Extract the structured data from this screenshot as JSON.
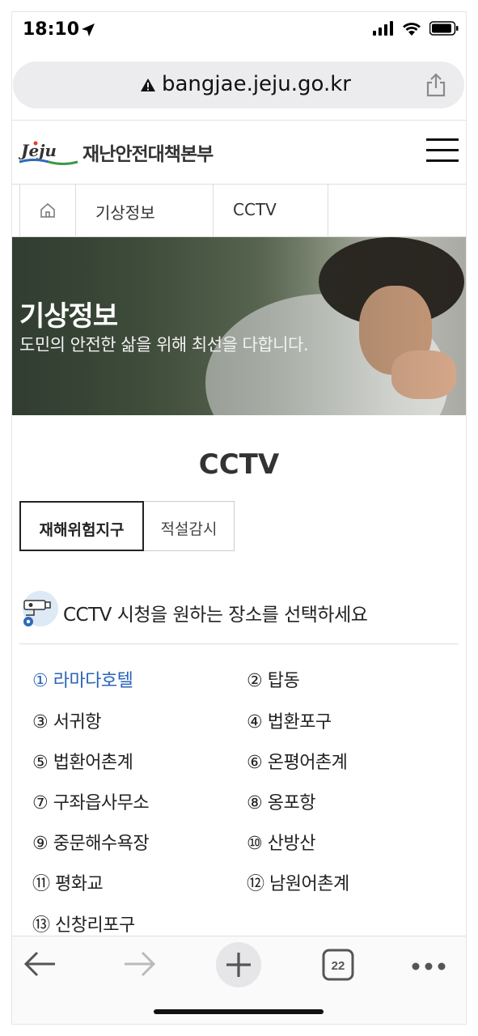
{
  "status_bar": {
    "time": "18:10",
    "icons": [
      "location-arrow-icon",
      "cellular-signal-icon",
      "wifi-icon",
      "battery-icon"
    ]
  },
  "browser": {
    "url": "bangjae.jeju.go.kr",
    "tab_count": "22"
  },
  "site": {
    "logo_text": "Jeju",
    "title": "재난안전대책본부"
  },
  "breadcrumb": {
    "items": [
      "기상정보",
      "CCTV"
    ]
  },
  "hero": {
    "title": "기상정보",
    "subtitle": "도민의 안전한 삶을 위해 최선을 다합니다."
  },
  "page": {
    "title": "CCTV",
    "tabs": [
      {
        "label": "재해위험지구",
        "active": true
      },
      {
        "label": "적설감시",
        "active": false
      }
    ],
    "instruction": "CCTV 시청을 원하는 장소를 선택하세요"
  },
  "locations": [
    {
      "label": "① 라마다호텔",
      "active": true
    },
    {
      "label": "② 탑동",
      "active": false
    },
    {
      "label": "③ 서귀항",
      "active": false
    },
    {
      "label": "④ 법환포구",
      "active": false
    },
    {
      "label": "⑤ 법환어촌계",
      "active": false
    },
    {
      "label": "⑥ 온평어촌계",
      "active": false
    },
    {
      "label": "⑦ 구좌읍사무소",
      "active": false
    },
    {
      "label": "⑧ 옹포항",
      "active": false
    },
    {
      "label": "⑨ 중문해수욕장",
      "active": false
    },
    {
      "label": "⑩ 산방산",
      "active": false
    },
    {
      "label": "⑪ 평화교",
      "active": false
    },
    {
      "label": "⑫ 남원어촌계",
      "active": false
    },
    {
      "label": "⑬ 신창리포구",
      "active": false
    }
  ],
  "colors": {
    "link_active": "#2a63b8",
    "url_bar_bg": "#ececef",
    "text_dark": "#222222"
  }
}
